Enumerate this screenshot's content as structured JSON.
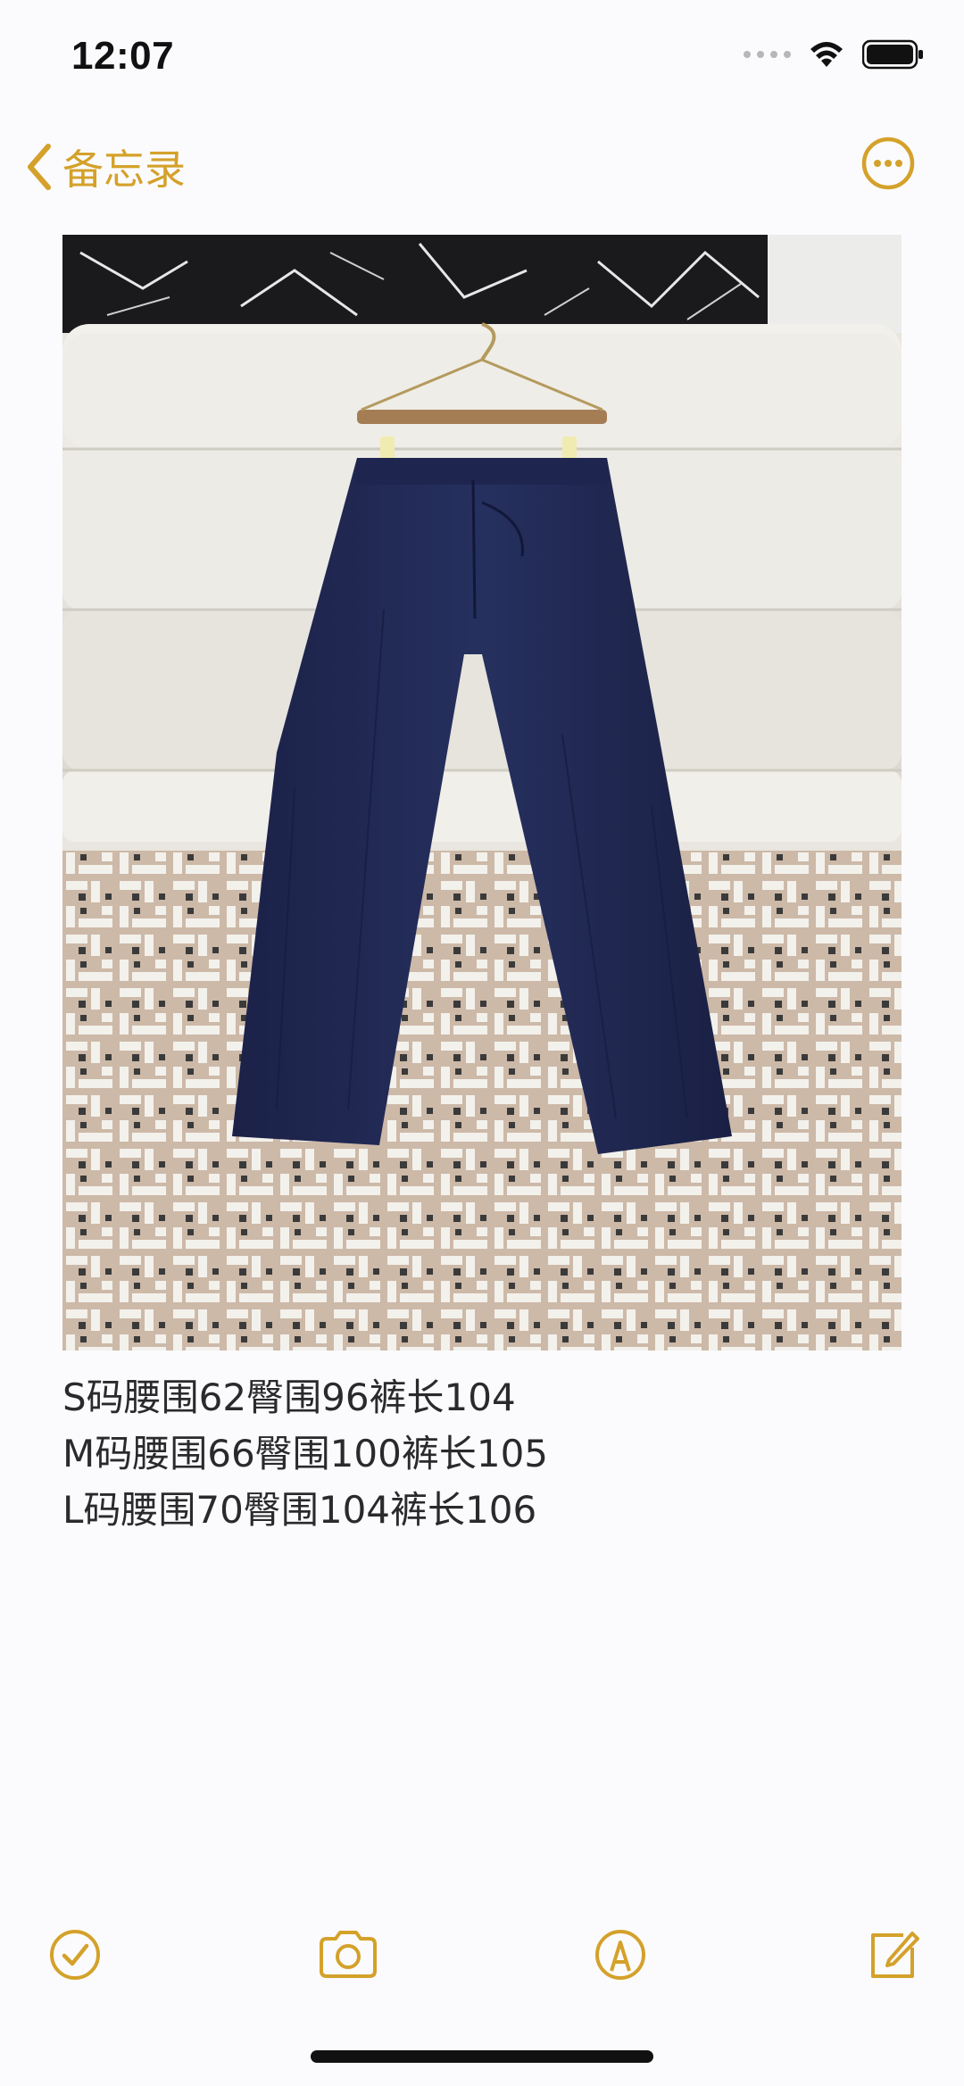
{
  "status_bar": {
    "time": "12:07"
  },
  "nav": {
    "back_label": "备忘录",
    "accent_color": "#d4a12a"
  },
  "photo": {
    "subject": "navy wide-leg trousers on hanger against white sofa"
  },
  "note": {
    "lines": [
      "S码腰围62臀围96裤长104",
      "M码腰围66臀围100裤长105",
      "L码腰围70臀围104裤长106"
    ]
  },
  "toolbar": {
    "icons": [
      "checklist-icon",
      "camera-icon",
      "markup-icon",
      "compose-icon"
    ]
  }
}
